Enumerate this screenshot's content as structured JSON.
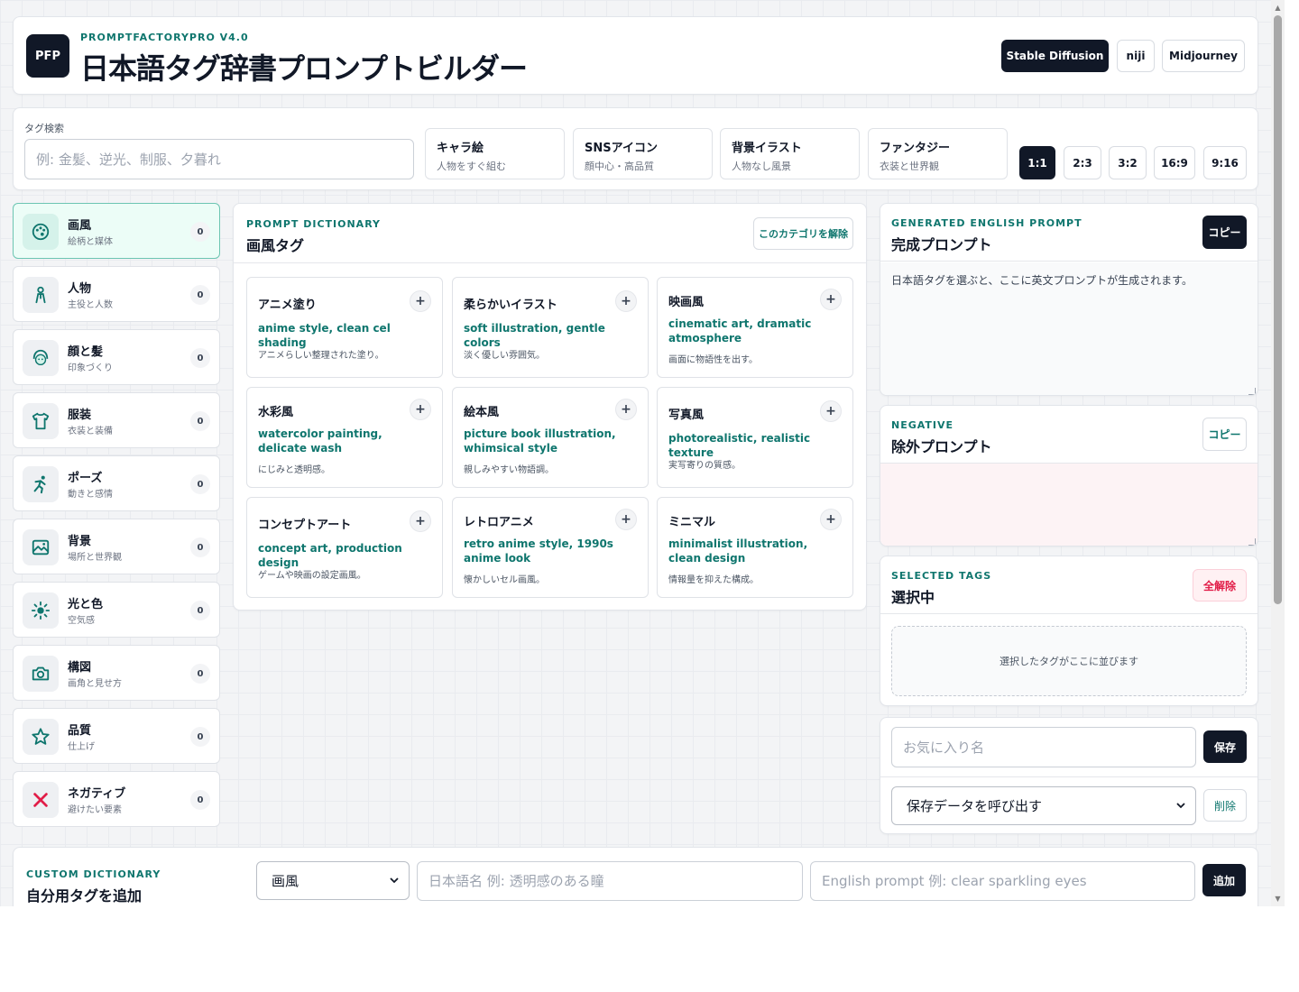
{
  "header": {
    "logo": "PFP",
    "brand": "PROMPTFACTORYPRO V4.0",
    "title": "日本語タグ辞書プロンプトビルダー",
    "models": [
      "Stable Diffusion",
      "niji",
      "Midjourney"
    ],
    "active_model": "Stable Diffusion"
  },
  "search": {
    "label": "タグ検索",
    "placeholder": "例: 金髪、逆光、制服、夕暮れ",
    "presets": [
      {
        "title": "キャラ絵",
        "sub": "人物をすぐ組む"
      },
      {
        "title": "SNSアイコン",
        "sub": "顔中心・高品質"
      },
      {
        "title": "背景イラスト",
        "sub": "人物なし風景"
      },
      {
        "title": "ファンタジー",
        "sub": "衣装と世界観"
      }
    ],
    "ratios": [
      "1:1",
      "2:3",
      "3:2",
      "16:9",
      "9:16"
    ],
    "active_ratio": "1:1"
  },
  "categories": [
    {
      "name": "画風",
      "sub": "絵柄と媒体",
      "count": "0",
      "icon": "palette-icon",
      "active": true
    },
    {
      "name": "人物",
      "sub": "主役と人数",
      "count": "0",
      "icon": "person-icon"
    },
    {
      "name": "顔と髪",
      "sub": "印象づくり",
      "count": "0",
      "icon": "face-hair-icon"
    },
    {
      "name": "服装",
      "sub": "衣装と装備",
      "count": "0",
      "icon": "shirt-icon"
    },
    {
      "name": "ポーズ",
      "sub": "動きと感情",
      "count": "0",
      "icon": "pose-icon"
    },
    {
      "name": "背景",
      "sub": "場所と世界観",
      "count": "0",
      "icon": "landscape-icon"
    },
    {
      "name": "光と色",
      "sub": "空気感",
      "count": "0",
      "icon": "sun-icon"
    },
    {
      "name": "構図",
      "sub": "画角と見せ方",
      "count": "0",
      "icon": "camera-icon"
    },
    {
      "name": "品質",
      "sub": "仕上げ",
      "count": "0",
      "icon": "star-icon"
    },
    {
      "name": "ネガティブ",
      "sub": "避けたい要素",
      "count": "0",
      "icon": "cross-icon"
    }
  ],
  "dictionary": {
    "eyebrow": "PROMPT DICTIONARY",
    "title": "画風タグ",
    "clear_label": "このカテゴリを解除",
    "tags": [
      {
        "name": "アニメ塗り",
        "en": "anime style, clean cel shading",
        "desc": "アニメらしい整理された塗り。"
      },
      {
        "name": "柔らかいイラスト",
        "en": "soft illustration, gentle colors",
        "desc": "淡く優しい雰囲気。"
      },
      {
        "name": "映画風",
        "en": "cinematic art, dramatic atmosphere",
        "desc": "画面に物語性を出す。"
      },
      {
        "name": "水彩風",
        "en": "watercolor painting, delicate wash",
        "desc": "にじみと透明感。"
      },
      {
        "name": "絵本風",
        "en": "picture book illustration, whimsical style",
        "desc": "親しみやすい物語調。"
      },
      {
        "name": "写真風",
        "en": "photorealistic, realistic texture",
        "desc": "実写寄りの質感。"
      },
      {
        "name": "コンセプトアート",
        "en": "concept art, production design",
        "desc": "ゲームや映画の設定画風。"
      },
      {
        "name": "レトロアニメ",
        "en": "retro anime style, 1990s anime look",
        "desc": "懐かしいセル画風。"
      },
      {
        "name": "ミニマル",
        "en": "minimalist illustration, clean design",
        "desc": "情報量を抑えた構成。"
      }
    ],
    "add_symbol": "+"
  },
  "output": {
    "eyebrow": "GENERATED ENGLISH PROMPT",
    "title": "完成プロンプト",
    "copy_label": "コピー",
    "text": "日本語タグを選ぶと、ここに英文プロンプトが生成されます。"
  },
  "negative": {
    "eyebrow": "NEGATIVE",
    "title": "除外プロンプト",
    "copy_label": "コピー",
    "text": ""
  },
  "selected": {
    "eyebrow": "SELECTED TAGS",
    "title": "選択中",
    "clear_all_label": "全解除",
    "empty_text": "選択したタグがここに並びます"
  },
  "favorites": {
    "name_placeholder": "お気に入り名",
    "save_label": "保存",
    "load_value": "保存データを呼び出す",
    "delete_label": "削除"
  },
  "custom": {
    "eyebrow": "CUSTOM DICTIONARY",
    "title": "自分用タグを追加",
    "category_value": "画風",
    "ja_placeholder": "日本語名 例: 透明感のある瞳",
    "en_placeholder": "English prompt 例: clear sparkling eyes",
    "add_label": "追加"
  },
  "colors": {
    "primary_dark": "#111827",
    "accent_teal": "#0f766e",
    "active_bg": "#ecfdf7",
    "negative_bg": "#fdf3f5",
    "danger": "#e11d48"
  }
}
